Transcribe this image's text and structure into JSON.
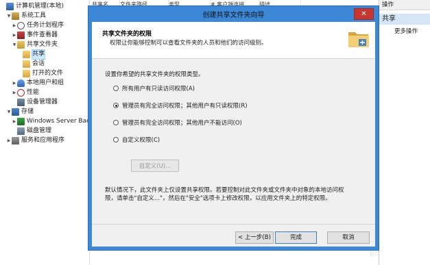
{
  "tree": {
    "items": [
      {
        "label": "计算机管理(本地)",
        "icon": "computer-icon",
        "arrow": "",
        "indent": 0
      },
      {
        "label": "系统工具",
        "icon": "tools-icon",
        "arrow": "▼",
        "indent": 1
      },
      {
        "label": "任务计划程序",
        "icon": "clock-icon",
        "arrow": "▶",
        "indent": 2
      },
      {
        "label": "事件查看器",
        "icon": "event-viewer-icon",
        "arrow": "▶",
        "indent": 2
      },
      {
        "label": "共享文件夹",
        "icon": "shared-folder-icon",
        "arrow": "▼",
        "indent": 2
      },
      {
        "label": "共享",
        "icon": "share-icon",
        "arrow": "",
        "indent": 3,
        "selected": true
      },
      {
        "label": "会话",
        "icon": "session-icon",
        "arrow": "",
        "indent": 3
      },
      {
        "label": "打开的文件",
        "icon": "open-files-icon",
        "arrow": "",
        "indent": 3
      },
      {
        "label": "本地用户和组",
        "icon": "users-icon",
        "arrow": "▶",
        "indent": 2
      },
      {
        "label": "性能",
        "icon": "performance-icon",
        "arrow": "▶",
        "indent": 2
      },
      {
        "label": "设备管理器",
        "icon": "device-manager-icon",
        "arrow": "",
        "indent": 2
      },
      {
        "label": "存储",
        "icon": "storage-icon",
        "arrow": "▼",
        "indent": 1
      },
      {
        "label": "Windows Server Back",
        "icon": "backup-icon",
        "arrow": "▶",
        "indent": 2
      },
      {
        "label": "磁盘管理",
        "icon": "disk-icon",
        "arrow": "",
        "indent": 2
      },
      {
        "label": "服务和应用程序",
        "icon": "services-icon",
        "arrow": "▶",
        "indent": 1
      }
    ]
  },
  "midlist": {
    "columns": [
      "共享名",
      "文件夹路径",
      "类型",
      "# 客户端连接",
      "描述"
    ]
  },
  "actions": {
    "header": "操作",
    "section": "共享",
    "more": "更多操作"
  },
  "dialog": {
    "title": "创建共享文件夹向导",
    "close": "✕",
    "heading": "共享文件夹的权限",
    "subheading": "权限让你能够控制可以查看文件夹的人员和他们的访问级别。",
    "prompt": "设置你希望的共享文件夹的权限类型。",
    "options": [
      {
        "label": "所有用户有只读访问权限(A)",
        "checked": false
      },
      {
        "label": "管理员有完全访问权限；其他用户有只读权限(R)",
        "checked": true
      },
      {
        "label": "管理员有完全访问权限；其他用户不能访问(O)",
        "checked": false
      },
      {
        "label": "自定义权限(C)",
        "checked": false
      }
    ],
    "custom_button": "自定义(U)...",
    "note_line1": "默认情况下，此文件夹上仅设置共享权限。若要控制对此文件夹或文件夹中对象的本地访问权",
    "note_line2": "限，请单击\"自定义...\"，然后在\"安全\"选项卡上修改权限，以应用文件夹上的特定权限。",
    "back_button": "< 上一步(B)",
    "finish_button": "完成",
    "cancel_button": "取消"
  }
}
